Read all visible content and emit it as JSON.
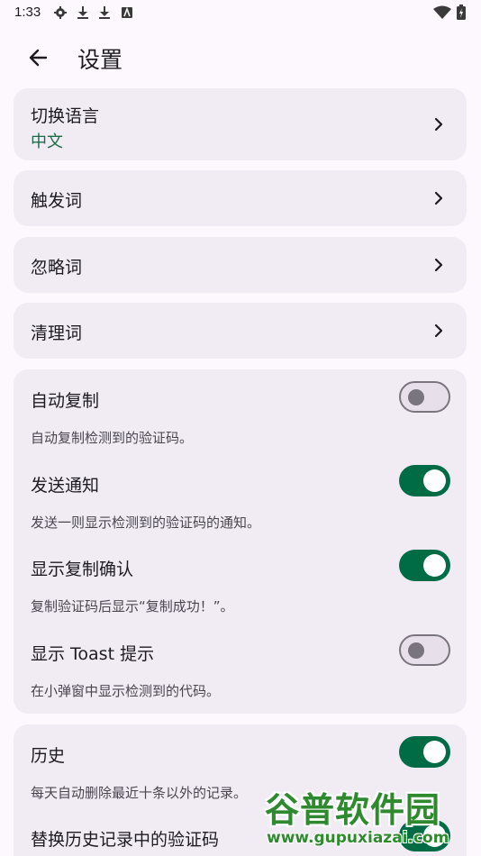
{
  "status_bar": {
    "time": "1:33",
    "left_icons": [
      "gear-icon",
      "download-icon",
      "download-icon",
      "app-icon"
    ],
    "right_icons": [
      "wifi-icon",
      "battery-icon"
    ]
  },
  "app_bar": {
    "title": "设置",
    "back_icon": "arrow-back-icon"
  },
  "nav_items": [
    {
      "label": "切换语言",
      "value": "中文"
    },
    {
      "label": "触发词"
    },
    {
      "label": "忽略词"
    },
    {
      "label": "清理词"
    }
  ],
  "toggles": [
    {
      "label": "自动复制",
      "description": "自动复制检测到的验证码。",
      "on": false
    },
    {
      "label": "发送通知",
      "description": "发送一则显示检测到的验证码的通知。",
      "on": true
    },
    {
      "label": "显示复制确认",
      "description": "复制验证码后显示“复制成功！”。",
      "on": true
    },
    {
      "label": "显示 Toast 提示",
      "description": "在小弹窗中显示检测到的代码。",
      "on": false
    }
  ],
  "history": {
    "label": "历史",
    "description": "每天自动删除最近十条以外的记录。",
    "on": true,
    "replace_label": "替换历史记录中的验证码"
  },
  "watermark": {
    "main": "谷普软件园",
    "url": "www.gupuxiazai.com"
  },
  "colors": {
    "background": "#fdf8fd",
    "card": "#f1ecf4",
    "accent": "#006c45",
    "value_text": "#1b6b47"
  }
}
